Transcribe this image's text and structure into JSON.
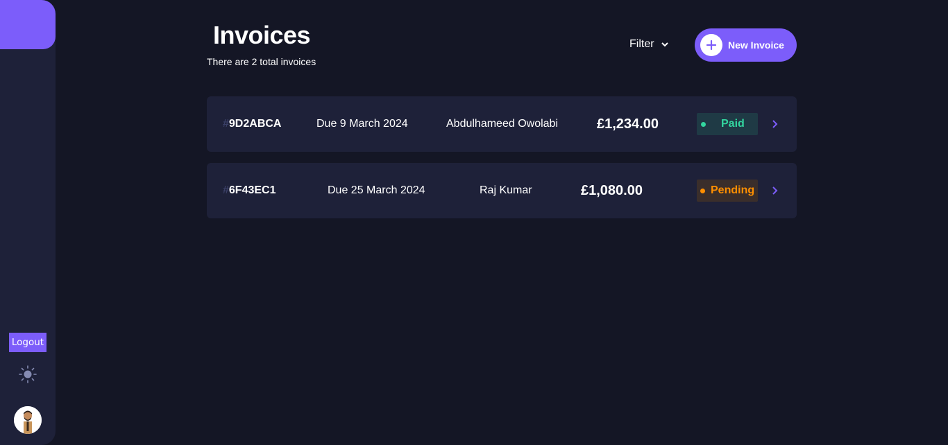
{
  "header": {
    "title": "Invoices",
    "subtitle": "There are 2 total invoices",
    "filter_label": "Filter",
    "new_invoice_label": "New Invoice"
  },
  "sidebar": {
    "logout_label": "Logout",
    "theme_icon": "sun-icon",
    "avatar_icon": "user-avatar"
  },
  "invoices": [
    {
      "hash": "#",
      "id": "9D2ABCA",
      "due": "Due 9 March 2024",
      "client": "Abdulhameed Owolabi",
      "amount": "£1,234.00",
      "status": "Paid"
    },
    {
      "hash": "#",
      "id": "6F43EC1",
      "due": "Due 25 March 2024",
      "client": "Raj Kumar",
      "amount": "£1,080.00",
      "status": "Pending"
    }
  ],
  "colors": {
    "background": "#141625",
    "panel": "#1E2139",
    "accent": "#7C5DFA",
    "paid": "#33D69F",
    "pending": "#FF8F00"
  }
}
